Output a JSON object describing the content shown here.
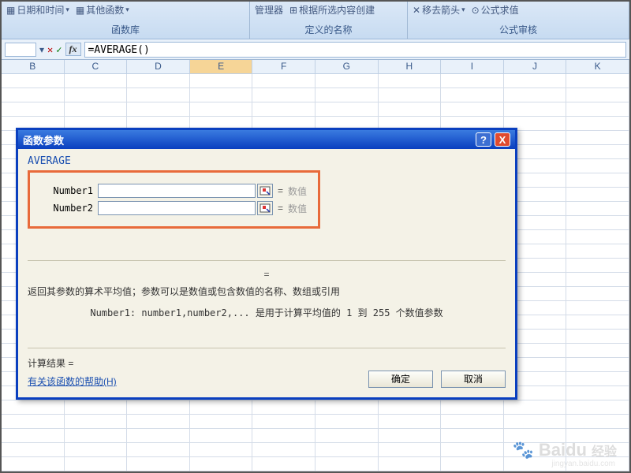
{
  "ribbon": {
    "group1": {
      "items": [
        "日期和时间",
        "其他函数"
      ],
      "label": "函数库"
    },
    "group2": {
      "items": [
        "管理器",
        "根据所选内容创建"
      ],
      "label": "定义的名称"
    },
    "group3": {
      "items": [
        "移去箭头",
        "公式求值"
      ],
      "label": "公式审核"
    }
  },
  "formula_bar": {
    "cancel": "✕",
    "confirm": "✓",
    "fx": "fx",
    "formula": "=AVERAGE()"
  },
  "columns": [
    "B",
    "C",
    "D",
    "E",
    "F",
    "G",
    "H",
    "I",
    "J",
    "K"
  ],
  "dialog": {
    "title": "函数参数",
    "help_icon": "?",
    "close_icon": "X",
    "function_name": "AVERAGE",
    "args": [
      {
        "label": "Number1",
        "hint": "数值"
      },
      {
        "label": "Number2",
        "hint": "数值"
      }
    ],
    "eq": "=",
    "description": "返回其参数的算术平均值；参数可以是数值或包含数值的名称、数组或引用",
    "param_desc": "Number1:  number1,number2,... 是用于计算平均值的 1 到 255 个数值参数",
    "result_label": "计算结果 =",
    "help_link": "有关该函数的帮助(H)",
    "ok": "确定",
    "cancel": "取消"
  },
  "watermark": {
    "brand": "Baidu",
    "sub": "经验",
    "url": "jingyan.baidu.com"
  }
}
